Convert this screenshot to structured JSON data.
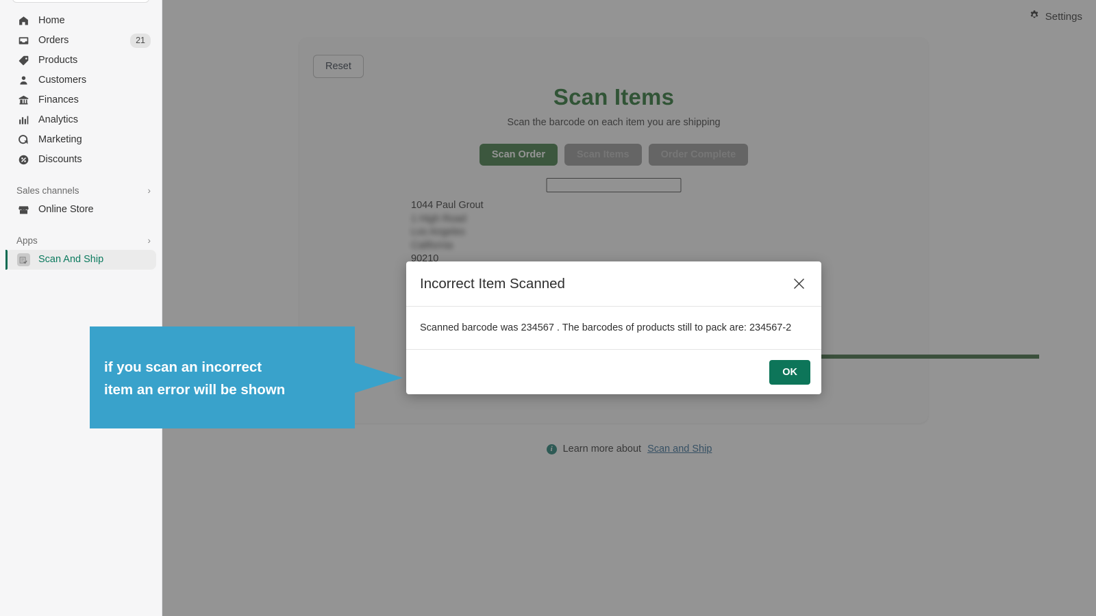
{
  "sidebar": {
    "items": [
      {
        "label": "Home",
        "icon": "home-icon",
        "badge": ""
      },
      {
        "label": "Orders",
        "icon": "orders-icon",
        "badge": "21"
      },
      {
        "label": "Products",
        "icon": "tag-icon",
        "badge": ""
      },
      {
        "label": "Customers",
        "icon": "person-icon",
        "badge": ""
      },
      {
        "label": "Finances",
        "icon": "bank-icon",
        "badge": ""
      },
      {
        "label": "Analytics",
        "icon": "bar-chart-icon",
        "badge": ""
      },
      {
        "label": "Marketing",
        "icon": "megaphone-icon",
        "badge": ""
      },
      {
        "label": "Discounts",
        "icon": "discount-icon",
        "badge": ""
      }
    ],
    "sales_channels_label": "Sales channels",
    "online_store_label": "Online Store",
    "apps_label": "Apps",
    "active_app_label": "Scan And Ship"
  },
  "topbar": {
    "settings_label": "Settings"
  },
  "main": {
    "reset_label": "Reset",
    "title": "Scan Items",
    "subtitle": "Scan the barcode on each item you are shipping",
    "steps": [
      {
        "label": "Scan Order",
        "state": "active"
      },
      {
        "label": "Scan Items",
        "state": "disabled"
      },
      {
        "label": "Order Complete",
        "state": "disabled"
      }
    ],
    "scan_input_value": "",
    "scan_input_placeholder": "",
    "address": {
      "line1": "1044 Paul Grout",
      "line2": "1 High Road",
      "line3": "Los Angeles",
      "line4": "California",
      "line5": "90210"
    }
  },
  "footer": {
    "learn_more_text": "Learn more about",
    "link_label": "Scan and Ship"
  },
  "modal": {
    "title": "Incorrect Item Scanned",
    "body": "Scanned barcode was 234567 . The barcodes of products still to pack are: 234567-2",
    "ok_label": "OK"
  },
  "callout": {
    "text": "if you scan an incorrect\nitem an error will be shown"
  },
  "colors": {
    "accent_green": "#13671f",
    "primary_button": "#2f6e32",
    "ok_button": "#0d7559",
    "callout_blue": "#39a2cb",
    "active_nav": "#0b7a5e",
    "green_bar": "#2c5d2f"
  }
}
